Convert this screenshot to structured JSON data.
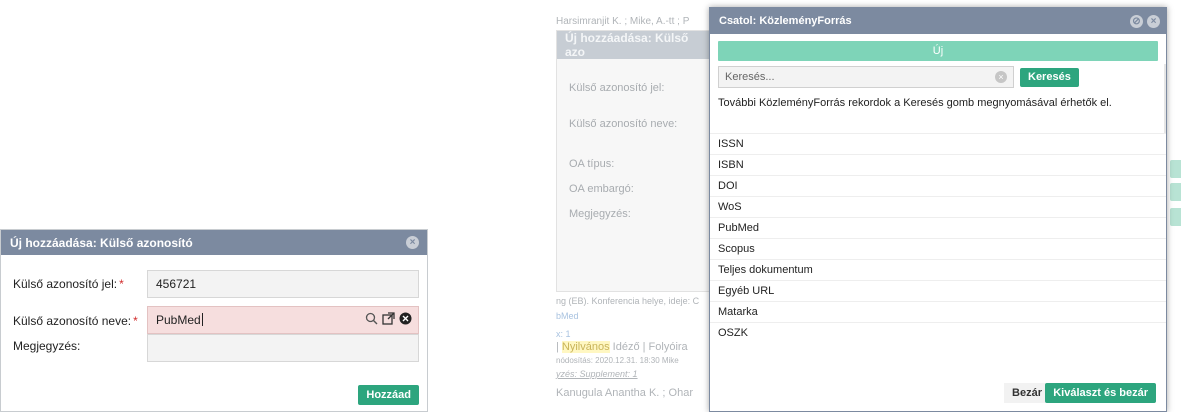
{
  "left_dialog": {
    "title": "Új hozzáadása: Külső azonosító",
    "fields": [
      {
        "label": "Külső azonosító jel:",
        "required": "*",
        "value": "456721"
      },
      {
        "label": "Külső azonosító neve:",
        "required": "*",
        "value": "PubMed"
      },
      {
        "label": "Megjegyzés:",
        "value": ""
      }
    ],
    "add_button": "Hozzáad"
  },
  "background_page": {
    "top_text": "Harsimranjit K. ; Mike, A.-tt ; P",
    "dialog_title": "Új hozzáadása: Külső azo",
    "labels": [
      "Külső azonosító jel:",
      "Külső azonosító neve:",
      "OA típus:",
      "OA embargó:",
      "Megjegyzés:"
    ],
    "lines": [
      "ng (EB). Konferencia helye, ideje: C",
      "bMed",
      "x: 1",
      "Nyilvános",
      "Idéző | Folyóira",
      "nódosítás: 2020.12.31. 18:30 Mike",
      "yzés: Supplement: 1",
      "Kanugula Anantha K. ;  Ohar"
    ]
  },
  "right_dialog": {
    "title": "Csatol: KözleményForrás",
    "new_label": "Új",
    "search": {
      "placeholder": "Keresés...",
      "button": "Keresés"
    },
    "info": "További KözleményForrás rekordok a Keresés gomb megnyomásával érhetők el.",
    "items": [
      "ISSN",
      "ISBN",
      "DOI",
      "WoS",
      "PubMed",
      "Scopus",
      "Teljes dokumentum",
      "Egyéb URL",
      "Matarka",
      "OSZK"
    ],
    "close_button": "Bezár",
    "select_close_button": "Kiválaszt és bezár"
  },
  "colors": {
    "titlebar": "#7c8aa0",
    "accent_green": "#2da57e",
    "new_bar": "#7ed4b8",
    "active_field": "#f6dede"
  },
  "icons": [
    "close-circle-icon",
    "search-icon",
    "open-external-icon",
    "clear-circle-icon"
  ]
}
